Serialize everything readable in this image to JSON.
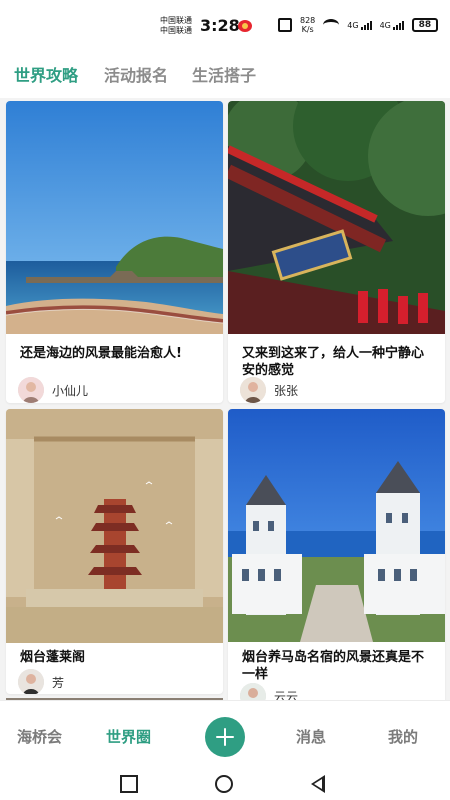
{
  "status": {
    "carrier1": "中国联通",
    "carrier2": "中国联通",
    "time": "3:28",
    "speed_value": "828",
    "speed_unit": "K/s",
    "network1": "4G",
    "network2": "4G",
    "battery": "88"
  },
  "top_tabs": [
    "世界攻略",
    "活动报名",
    "生活搭子"
  ],
  "posts": [
    {
      "title": "还是海边的风景最能治愈人!",
      "author": "小仙儿"
    },
    {
      "title": "又来到这来了，给人一种宁静心安的感觉",
      "author": "张张"
    },
    {
      "title": "烟台蓬莱阁",
      "author": "芳"
    },
    {
      "title": "烟台养马岛名宿的风景还真是不一样",
      "author": "云云"
    }
  ],
  "bottom_nav": {
    "items": [
      "海桥会",
      "世界圈",
      "消息",
      "我的"
    ]
  },
  "colors": {
    "accent": "#2f9e83"
  }
}
